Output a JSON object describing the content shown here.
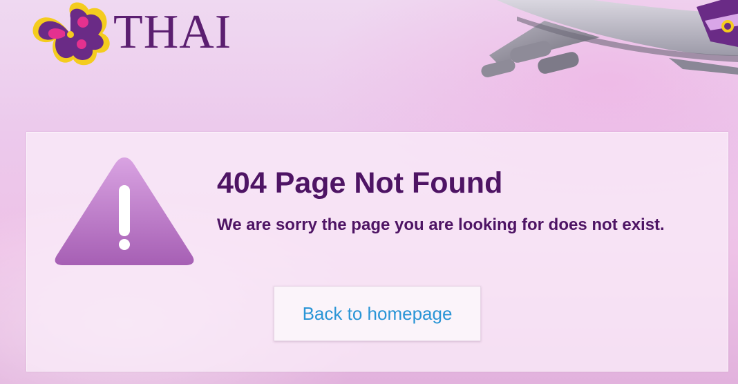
{
  "brand": {
    "name": "THAI",
    "logo_icon": "thai-orchid-logo-icon"
  },
  "decor": {
    "plane_image": "airplane-image"
  },
  "error": {
    "icon": "warning-icon",
    "title": "404 Page Not Found",
    "message": "We are sorry the page you are looking for does not exist."
  },
  "actions": {
    "back_label": "Back to homepage"
  },
  "colors": {
    "brand_purple": "#5b1e70",
    "title_purple": "#4e1464",
    "link_blue": "#2a95d6",
    "warning_purple": "#b56fc1"
  }
}
